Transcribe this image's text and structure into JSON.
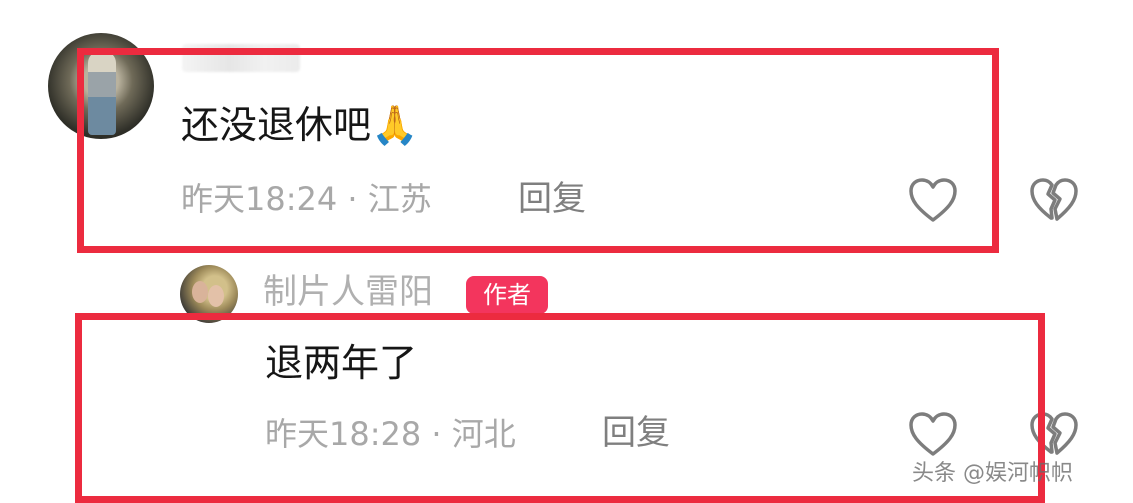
{
  "comments": [
    {
      "text": "还没退休吧🙏",
      "meta": "昨天18:24 · 江苏",
      "reply_label": "回复"
    },
    {
      "author": "制片人雷阳",
      "badge": "作者",
      "text": "退两年了",
      "meta": "昨天18:28 · 河北",
      "reply_label": "回复"
    }
  ],
  "watermark": "头条 @娱河帜帜",
  "icons": {
    "like": "heart-outline-icon",
    "dislike": "broken-heart-outline-icon"
  },
  "colors": {
    "highlight_box": "#ec2b3f",
    "author_badge": "#f3355d",
    "meta_text": "#a8a8a8"
  }
}
